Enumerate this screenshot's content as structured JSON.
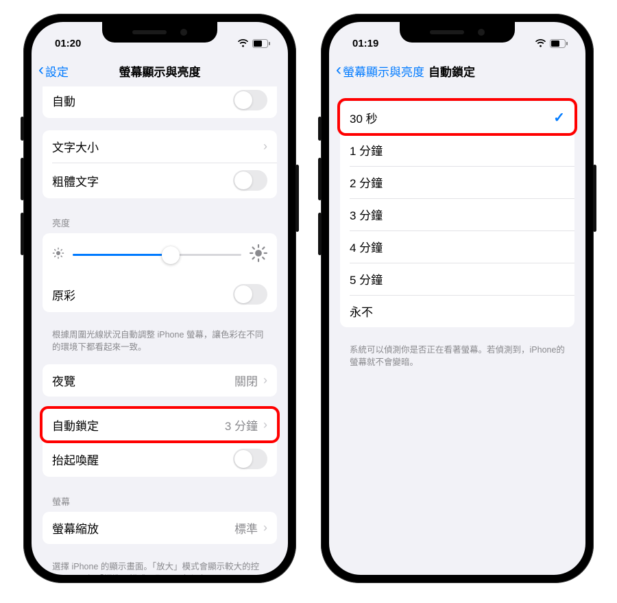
{
  "phone1": {
    "status_time": "01:20",
    "nav_back": "設定",
    "nav_title": "螢幕顯示與亮度",
    "auto_label": "自動",
    "text_size_label": "文字大小",
    "bold_text_label": "粗體文字",
    "brightness_header": "亮度",
    "brightness_value_pct": 58,
    "true_tone_label": "原彩",
    "true_tone_footer": "根據周圍光線狀況自動調整 iPhone 螢幕，讓色彩在不同的環境下都看起來一致。",
    "night_shift_label": "夜覽",
    "night_shift_value": "關閉",
    "auto_lock_label": "自動鎖定",
    "auto_lock_value": "3 分鐘",
    "raise_to_wake_label": "抬起喚醒",
    "screen_header": "螢幕",
    "display_zoom_label": "螢幕縮放",
    "display_zoom_value": "標準",
    "display_zoom_footer": "選擇 iPhone 的顯示畫面。「放大」模式會顯示較大的控制項目，但「標準」模式可顯示更多內容。"
  },
  "phone2": {
    "status_time": "01:19",
    "nav_back": "螢幕顯示與亮度",
    "nav_title": "自動鎖定",
    "options": [
      "30 秒",
      "1 分鐘",
      "2 分鐘",
      "3 分鐘",
      "4 分鐘",
      "5 分鐘",
      "永不"
    ],
    "selected_index": 0,
    "footer": "系統可以偵測你是否正在看著螢幕。若偵測到，iPhone的螢幕就不會變暗。"
  }
}
